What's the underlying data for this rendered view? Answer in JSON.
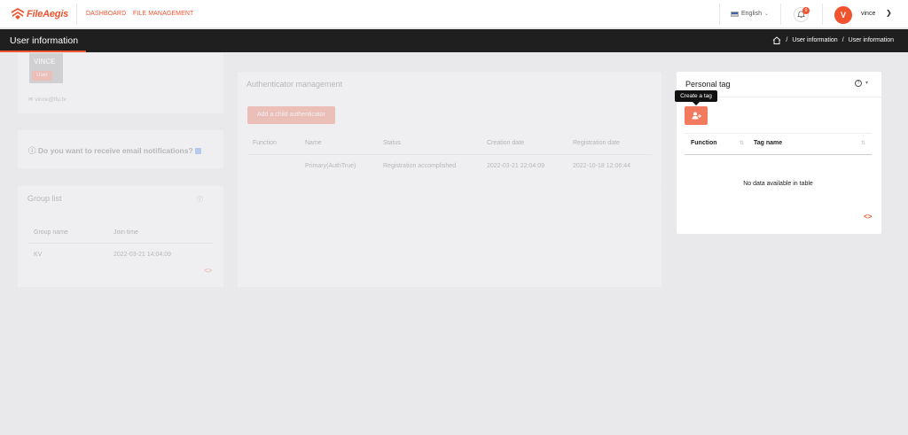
{
  "app": {
    "logo_text": "FileAegis"
  },
  "nav": {
    "dashboard": "DASHBOARD",
    "file_management": "FILE MANAGEMENT"
  },
  "top_right": {
    "language": "English",
    "notifications_count": "0",
    "avatar_initial": "V",
    "username": "vince"
  },
  "header": {
    "title": "User information",
    "breadcrumb": [
      "User information",
      "User information"
    ]
  },
  "user_card": {
    "name": "VINCE",
    "role": "User",
    "email": "vince@lfu.tv"
  },
  "email_notif": {
    "question": "Do you want to receive email notifications?"
  },
  "group_list": {
    "title": "Group list",
    "columns": [
      "Group name",
      "Join time"
    ],
    "rows": [
      {
        "group": "KV",
        "join_time": "2022-03-21 14:04:09"
      }
    ]
  },
  "authenticator": {
    "title": "Authenticator management",
    "add_button": "Add a child authenticator",
    "columns": [
      "Function",
      "Name",
      "Status",
      "Creation date",
      "Registration date"
    ],
    "rows": [
      {
        "name": "Primary(AuthTrue)",
        "status": "Registration accomplished",
        "creation": "2022-03-21 22:04:09",
        "registration": "2022-10-18 12:06:44"
      }
    ]
  },
  "personal_tag": {
    "title": "Personal tag",
    "tooltip": "Create a tag",
    "columns": [
      "Function",
      "Tag name"
    ],
    "empty": "No data available in table"
  },
  "colors": {
    "accent": "#f0532f",
    "header_bg": "#1f1f1f"
  }
}
